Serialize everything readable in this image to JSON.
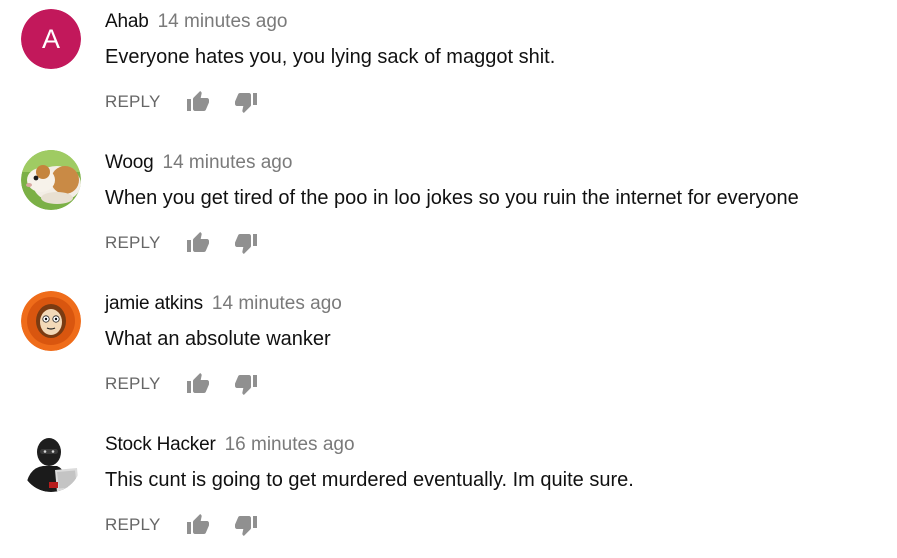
{
  "comments": [
    {
      "author": "Ahab",
      "timestamp": "14 minutes ago",
      "text": "Everyone hates you, you lying sack of maggot shit.",
      "avatar": {
        "type": "letter",
        "letter": "A",
        "color": "#c2185b"
      },
      "reply_label": "REPLY"
    },
    {
      "author": "Woog",
      "timestamp": "14 minutes ago",
      "text": "When you get tired of the poo in loo jokes so you ruin the internet for everyone",
      "avatar": {
        "type": "image",
        "subject": "guinea-pig-on-grass"
      },
      "reply_label": "REPLY"
    },
    {
      "author": "jamie atkins",
      "timestamp": "14 minutes ago",
      "text": "What an absolute wanker",
      "avatar": {
        "type": "image",
        "subject": "orange-hooded-cartoon"
      },
      "reply_label": "REPLY"
    },
    {
      "author": "Stock Hacker",
      "timestamp": "16 minutes ago",
      "text": "This cunt is going to get murdered eventually. Im quite sure.",
      "avatar": {
        "type": "image",
        "subject": "hooded-hacker-laptop"
      },
      "reply_label": "REPLY"
    }
  ],
  "icons": {
    "like": "thumbs-up-icon",
    "dislike": "thumbs-down-icon"
  },
  "colors": {
    "icon": "#909090",
    "author": "#0f0f0f",
    "timestamp": "#7a7a7a",
    "reply": "#666666"
  }
}
